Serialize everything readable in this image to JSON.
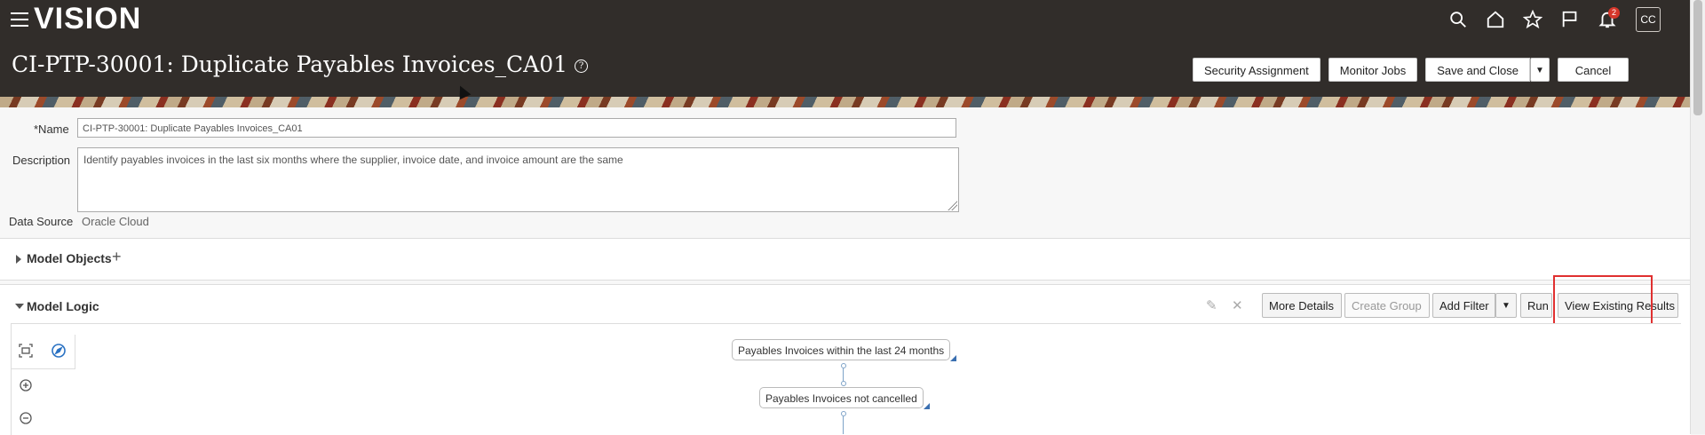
{
  "app": {
    "logo": "VISION",
    "user_initials": "CC",
    "notification_count": "2"
  },
  "page": {
    "title": "CI-PTP-30001: Duplicate Payables Invoices_CA01"
  },
  "header_buttons": {
    "security": "Security Assignment",
    "monitor": "Monitor Jobs",
    "save_close": "Save and Close",
    "cancel": "Cancel"
  },
  "form": {
    "name_label": "*Name",
    "name_value": "CI-PTP-30001: Duplicate Payables Invoices_CA01",
    "description_label": "Description",
    "description_value": "Identify payables invoices in the last six months where the supplier, invoice date, and invoice amount are the same",
    "data_source_label": "Data Source",
    "data_source_value": "Oracle Cloud"
  },
  "model_objects": {
    "title": "Model Objects"
  },
  "model_logic": {
    "title": "Model Logic",
    "buttons": {
      "more_details": "More Details",
      "create_group": "Create Group",
      "add_filter": "Add Filter",
      "run": "Run",
      "view_results": "View Existing Results"
    },
    "nodes": [
      "Payables Invoices within the last 24 months",
      "Payables Invoices not cancelled"
    ]
  },
  "icons": [
    "menu-icon",
    "search-icon",
    "home-icon",
    "star-icon",
    "flag-icon",
    "bell-icon",
    "help-icon",
    "plus-icon",
    "pencil-icon",
    "close-icon",
    "fit-view-icon",
    "compass-icon",
    "zoom-in-icon",
    "zoom-out-icon"
  ]
}
